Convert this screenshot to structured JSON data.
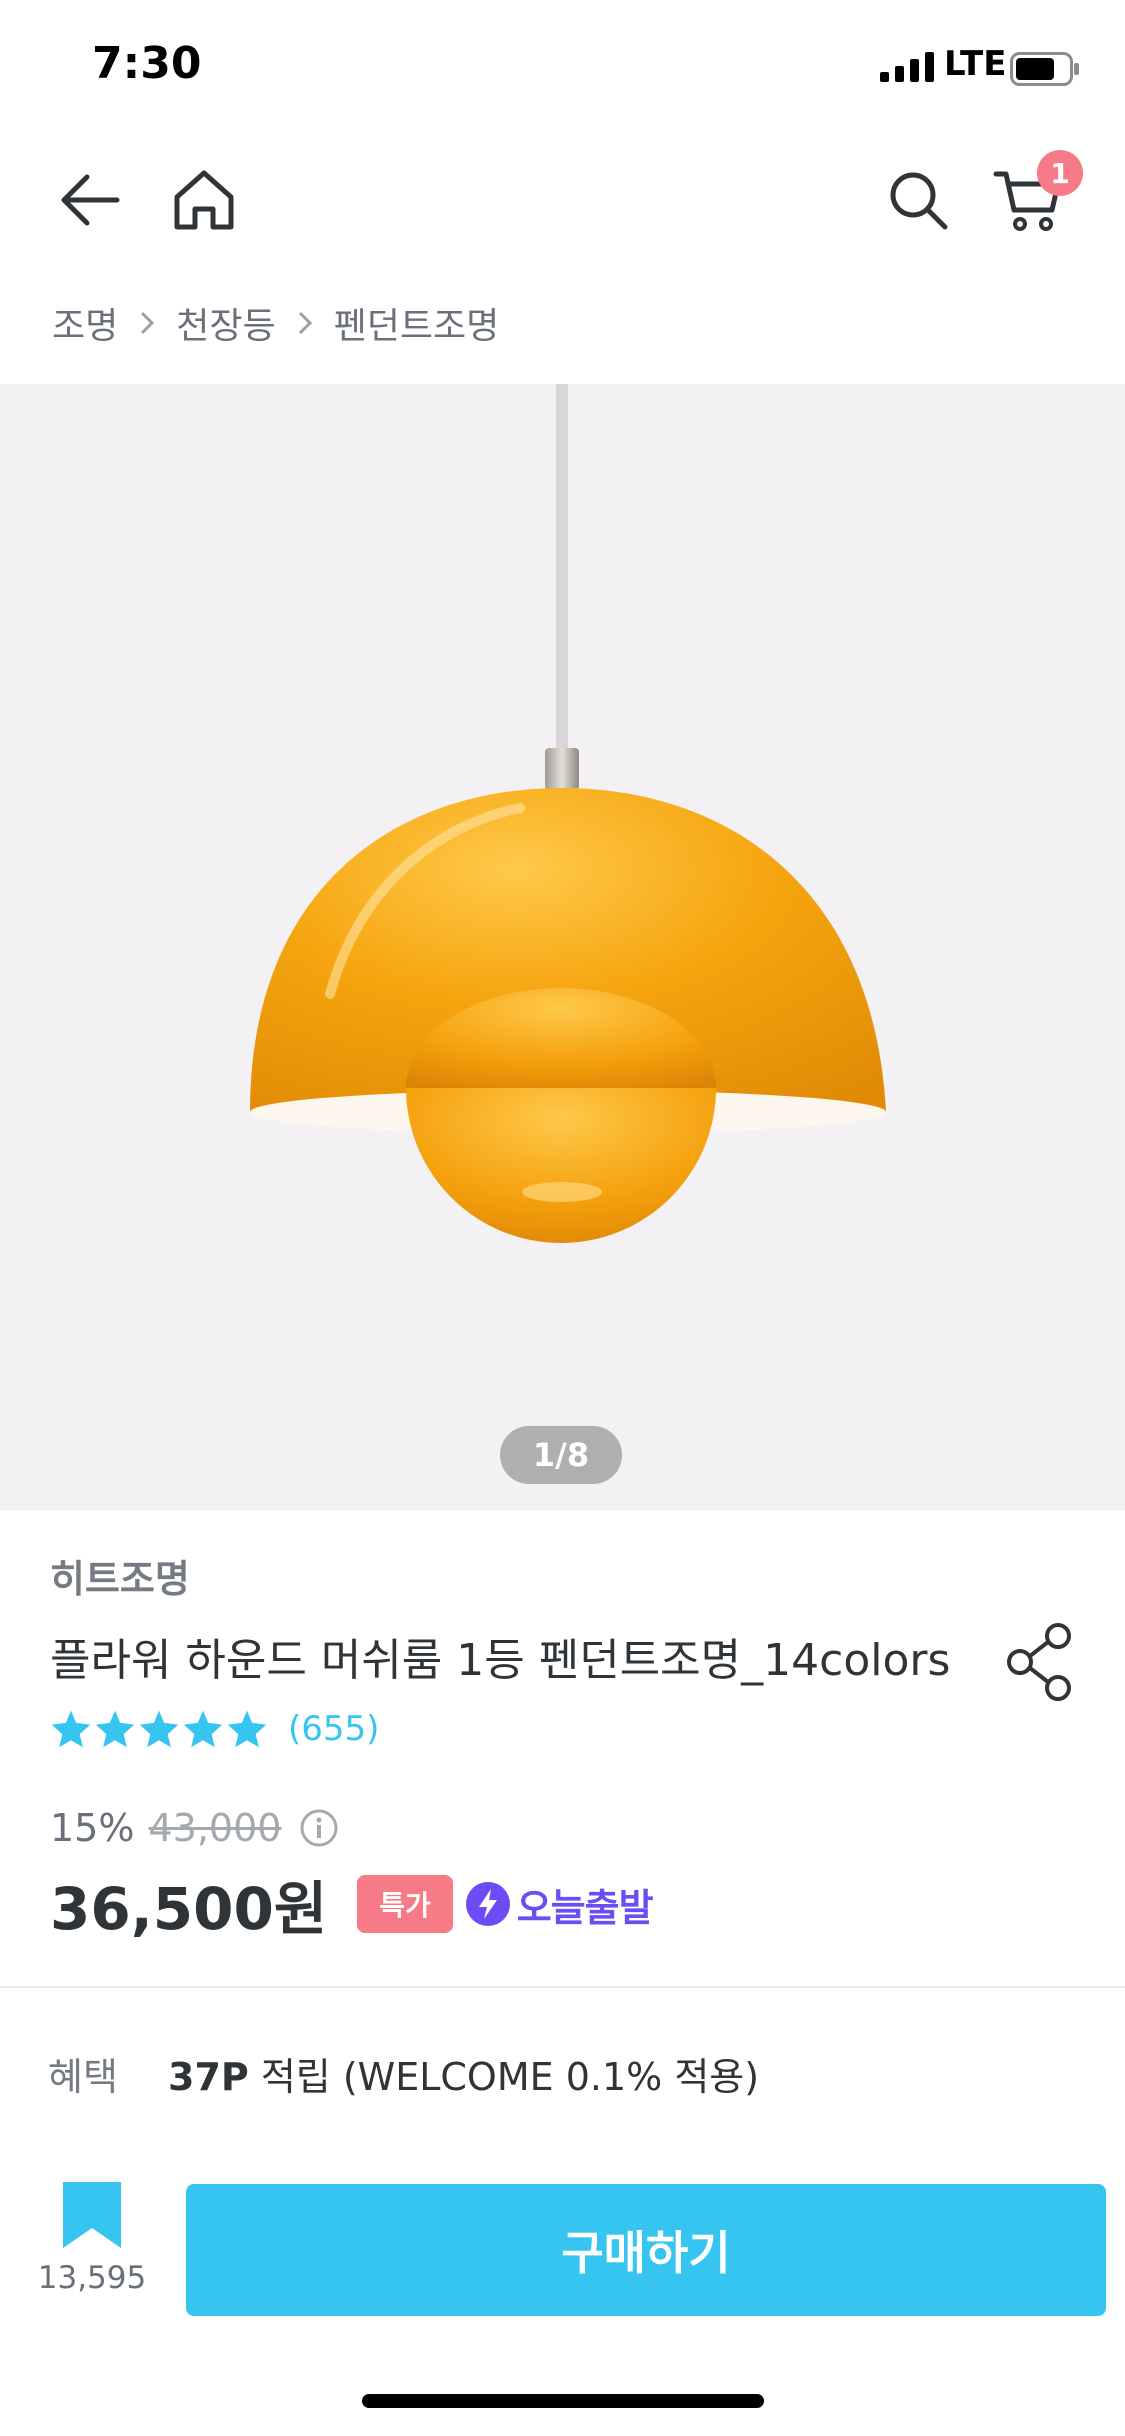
{
  "status_bar": {
    "time": "7:30",
    "network": "LTE"
  },
  "header": {
    "cart_count": "1"
  },
  "breadcrumb": [
    "조명",
    "천장등",
    "펜던트조명"
  ],
  "gallery": {
    "counter": "1/8"
  },
  "product": {
    "brand": "히트조명",
    "title": "플라워 하운드 머쉬룸 1등 펜던트조명_14colors",
    "rating_stars": 5,
    "review_count": "(655)",
    "discount": "15%",
    "original_price": "43,000",
    "sale_price": "36,500원",
    "special_badge": "특가",
    "today_shipping": "오늘출발"
  },
  "benefit": {
    "label": "혜택",
    "points": "37P",
    "detail": " 적립 (WELCOME 0.1% 적용)"
  },
  "bottom_bar": {
    "bookmark_count": "13,595",
    "buy_label": "구매하기"
  },
  "colors": {
    "accent": "#35c5f0",
    "badge_red": "#f77b86",
    "shipping_purple": "#6c4df5",
    "lamp_orange": "#f5a50f"
  }
}
